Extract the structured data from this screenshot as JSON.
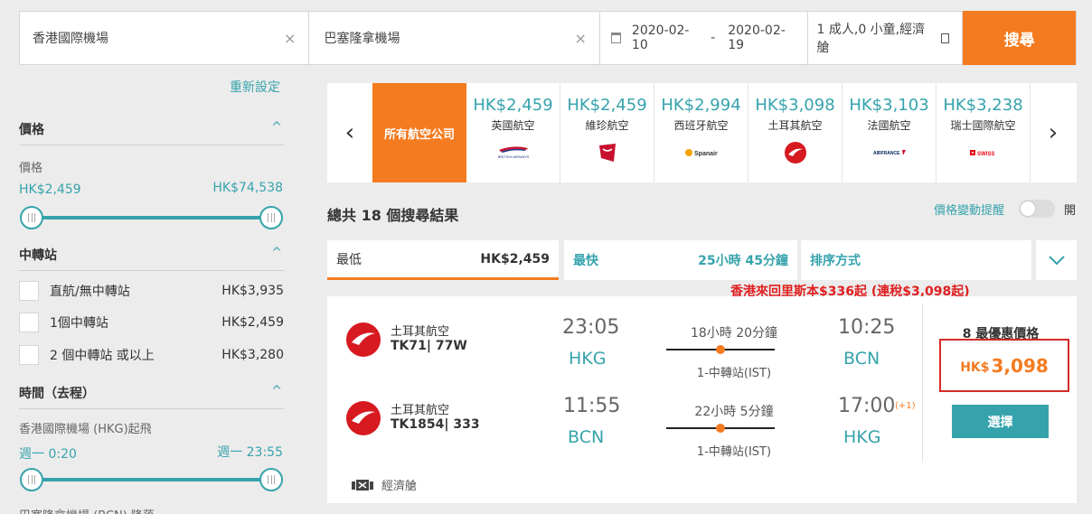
{
  "search": {
    "origin": "香港國際機場",
    "destination": "巴塞隆拿機場",
    "date_from": "2020-02-10",
    "date_sep": "-",
    "date_to": "2020-02-19",
    "passengers": "1 成人,0 小童,經濟艙",
    "search_label": "搜尋",
    "clear_icon": "×"
  },
  "filters": {
    "reset_label": "重新設定",
    "price": {
      "title": "價格",
      "label": "價格",
      "min": "HK$2,459",
      "max": "HK$74,538"
    },
    "stops": {
      "title": "中轉站",
      "options": [
        {
          "label": "直航/無中轉站",
          "price": "HK$3,935"
        },
        {
          "label": "1個中轉站",
          "price": "HK$2,459"
        },
        {
          "label": "2 個中轉站 或以上",
          "price": "HK$3,280"
        }
      ]
    },
    "time": {
      "title": "時間（去程）",
      "label": "香港國際機場 (HKG)起飛",
      "min": "週一 0:20",
      "max": "週一 23:55",
      "next_label": "巴塞隆拿機場 (BCN) 降落"
    }
  },
  "airlines": {
    "all_label": "所有航空公司",
    "items": [
      {
        "price": "HK$2,459",
        "name": "英國航空",
        "logo": "british-airways-logo"
      },
      {
        "price": "HK$2,459",
        "name": "維珍航空",
        "logo": "virgin-logo"
      },
      {
        "price": "HK$2,994",
        "name": "西班牙航空",
        "logo": "spanair-logo"
      },
      {
        "price": "HK$3,098",
        "name": "土耳其航空",
        "logo": "turkish-logo"
      },
      {
        "price": "HK$3,103",
        "name": "法國航空",
        "logo": "air-france-logo"
      },
      {
        "price": "HK$3,238",
        "name": "瑞士國際航空",
        "logo": "swiss-logo"
      }
    ],
    "logo_text": {
      "ba": "BRITISH AIRWAYS",
      "spanair": "Spanair",
      "af": "AIRFRANCE",
      "swiss": "SWISS"
    }
  },
  "results": {
    "total_label": "總共 18 個搜尋結果",
    "price_alert_label": "價格變動提醒",
    "toggle_label": "開",
    "tabs": {
      "cheapest_label": "最低",
      "cheapest_value": "HK$2,459",
      "fastest_label": "最快",
      "fastest_value": "25小時 45分鐘",
      "sort_label": "排序方式"
    },
    "promo": "香港來回里斯本$336起 (連稅$3,098起)"
  },
  "flight": {
    "outbound": {
      "airline": "土耳其航空",
      "flight_no": "TK71| 77W",
      "dep_time": "23:05",
      "dep_airport": "HKG",
      "duration": "18小時 20分鐘",
      "stops": "1-中轉站(IST)",
      "arr_time": "10:25",
      "arr_airport": "BCN"
    },
    "inbound": {
      "airline": "土耳其航空",
      "flight_no": "TK1854| 333",
      "dep_time": "11:55",
      "dep_airport": "BCN",
      "duration": "22小時 5分鐘",
      "stops": "1-中轉站(IST)",
      "arr_time": "17:00",
      "arr_day_offset": "(+1)",
      "arr_airport": "HKG"
    },
    "best_label": "8 最優惠價格",
    "currency": "HK$",
    "price": "3,098",
    "select_label": "選擇",
    "cabin": "經濟艙"
  },
  "colors": {
    "accent": "#f47b20",
    "teal": "#36a3ac",
    "promo_red": "#e02020"
  }
}
